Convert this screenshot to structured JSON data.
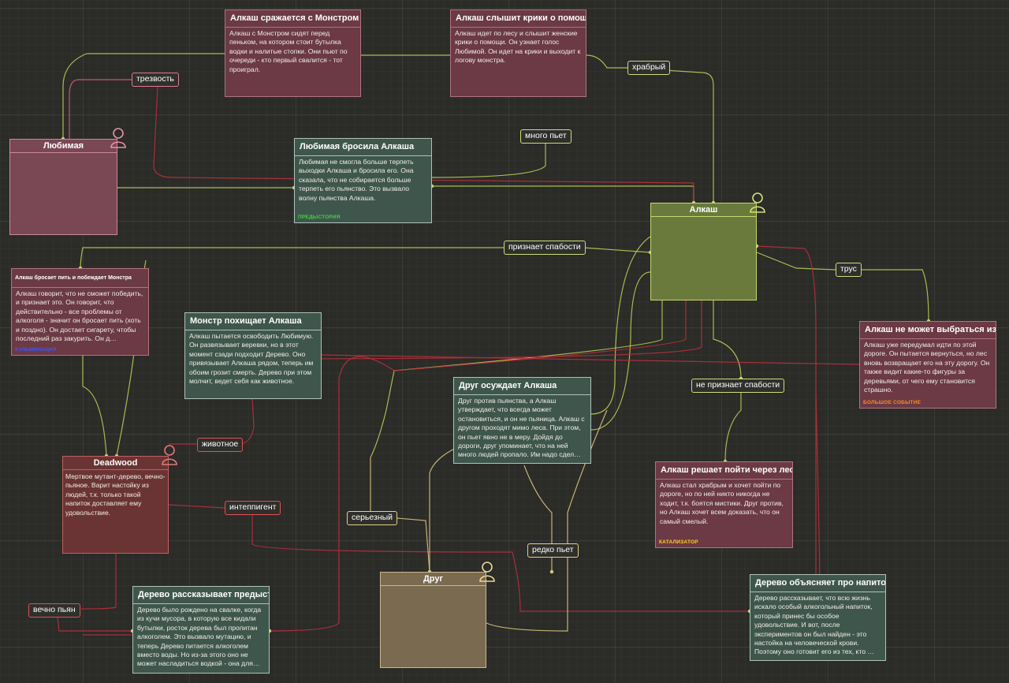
{
  "characters": {
    "lyubimaya": {
      "name": "Любимая",
      "color": "#7a4755"
    },
    "alkash": {
      "name": "Алкаш",
      "color": "#6a7a3c"
    },
    "deadwood": {
      "name": "Deadwood",
      "body": "Мертвое мутант-дерево, вечно-пьяное. Варит настойку из людей, т.к. только такой напиток доставляет ему удовольствие.",
      "color": "#6b3434"
    },
    "drug": {
      "name": "Друг",
      "color": "#7a6a4f"
    }
  },
  "cards": {
    "fight": {
      "title": "Алкаш сражается с Монстром",
      "body": "Алкаш с Монстром сидят перед пеньком, на котором стоит бутылка водки и налитые стопки. Они пьют по очереди - кто первый свалится - тот проиграл."
    },
    "cries": {
      "title": "Алкаш слышит крики о помощи",
      "body": "Алкаш идет по лесу и слышит женские крики о помощи. Он узнает голос Любимой. Он идет на крики и выходит к логову монстра."
    },
    "left": {
      "title": "Любимая бросила Алкаша",
      "body": "Любимая не смогла больше терпеть выходки Алкаша и бросила его. Она сказала, что не собирается больше терпеть его пьянство. Это вызвало волну пьянства Алкаша.",
      "tag": "ПРЕДЫСТОРИЯ"
    },
    "quits": {
      "title": "Алкаш бросает пить и побеждает Монстра",
      "body": "Алкаш говорит, что не сможет победить, и признает это. Он говорит, что действительно - все проблемы от алкоголя - значит он бросает пить (хоть и поздно). Он достает сигарету, чтобы последний раз закурить. Он д…",
      "tag": "КУЛЬМИНАЦИЯ"
    },
    "kidnap": {
      "title": "Монстр похищает Алкаша",
      "body": "Алкаш пытается освободить Любимую. Он развязывает веревки, но в этот момент сзади подходит Дерево. Оно привязывает Алкаша рядом, теперь им обоим грозит смерть. Дерево при этом молчит, ведет себя как животное."
    },
    "condemn": {
      "title": "Друг осуждает Алкаша",
      "body": "Друг против пьянства, а Алкаш утверждает, что всегда может остановиться, и он не пьяница. Алкаш с другом проходят мимо леса. При этом, он пьет явно не в меру. Дойдя до дороги, друг упоминает, что на ней много людей пропало. Им надо сдел…"
    },
    "lost": {
      "title": "Алкаш не может выбраться из лесу",
      "body": "Алкаш уже передумал идти по этой дороге. Он пытается вернуться, но лес вновь возвращает его на эту дорогу. Он также видит какие-то фигуры за деревьями, от чего ему становится страшно.",
      "tag": "БОЛЬШОЕ СОБЫТИЕ"
    },
    "decides": {
      "title": "Алкаш решает пойти через лес",
      "body": "Алкаш стал храбрым и хочет пойти по дороге, но по ней никто никогда не ходит, т.к. боятся мистики. Друг против, но Алкаш хочет всем доказать, что он самый смелый.",
      "tag": "КАТАЛИЗАТОР"
    },
    "backstory": {
      "title": "Дерево рассказывает предысторию",
      "body": "Дерево было рождено на свалке, когда из кучи мусора, в которую все кидали бутылки, росток дерева был пропитан алкоголем. Это вызвало мутацию, и теперь Дерево питается алкоголем вместо воды. Но из-за этого оно не может насладиться водкой - она для…"
    },
    "drink": {
      "title": "Дерево объясняет про напиток",
      "body": "Дерево рассказывает, что всю жизнь искало особый алкогольный напиток, который принес бы особое удовольствие. И вот, после экспериментов он был найден - это настойка на человеческой крови. Поэтому оно готовит его из тех, кто …"
    }
  },
  "labels": {
    "sobriety": "трезвость",
    "brave": "храбрый",
    "drinks_a_lot": "много пьет",
    "admits": "признает спабости",
    "coward": "трус",
    "not_admits": "не признает спабости",
    "animal": "животное",
    "intelligent": "интеппигент",
    "serious": "серьезный",
    "rarely": "редко пьет",
    "always_drunk": "вечно пьян"
  },
  "colors": {
    "background": "#2b2b28",
    "wire_green": "#b6cc55",
    "wire_red": "#b8303a",
    "wire_yellow": "#d8c27e",
    "wire_pink": "#d85a7a",
    "tag_green": "#3fd33f",
    "tag_blue": "#3a58ff",
    "tag_orange": "#ff8a1e",
    "tag_yellow": "#ffd21e"
  },
  "icons": [
    "person-outline-icon"
  ]
}
